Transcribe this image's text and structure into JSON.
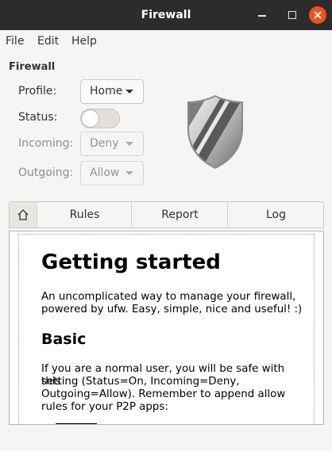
{
  "window": {
    "title": "Firewall"
  },
  "menu": [
    "File",
    "Edit",
    "Help"
  ],
  "section": {
    "title": "Firewall"
  },
  "settings": {
    "profile": {
      "label": "Profile:",
      "value": "Home"
    },
    "status": {
      "label": "Status:",
      "on": false
    },
    "incoming": {
      "label": "Incoming:",
      "value": "Deny"
    },
    "outgoing": {
      "label": "Outgoing:",
      "value": "Allow"
    }
  },
  "tabs": [
    "Rules",
    "Report",
    "Log"
  ],
  "content": {
    "heading": "Getting started",
    "intro_1": "An uncomplicated way to manage your firewall,",
    "intro_2": "powered by ufw. Easy, simple, nice and useful! :)",
    "subheading": "Basic",
    "basic_1": "If you are a normal user, you will be safe with this",
    "basic_2": "setting (Status=On, Incoming=Deny,",
    "basic_3": "Outgoing=Allow). Remember to append allow",
    "basic_4": "rules for your P2P apps:"
  },
  "colors": {
    "titlebar": "#2c2c2c",
    "close": "#e95420",
    "window_bg": "#f6f5f4"
  },
  "icons": [
    "minimize-icon",
    "maximize-icon",
    "close-icon",
    "shield-icon",
    "home-icon",
    "chevron-down-icon"
  ]
}
